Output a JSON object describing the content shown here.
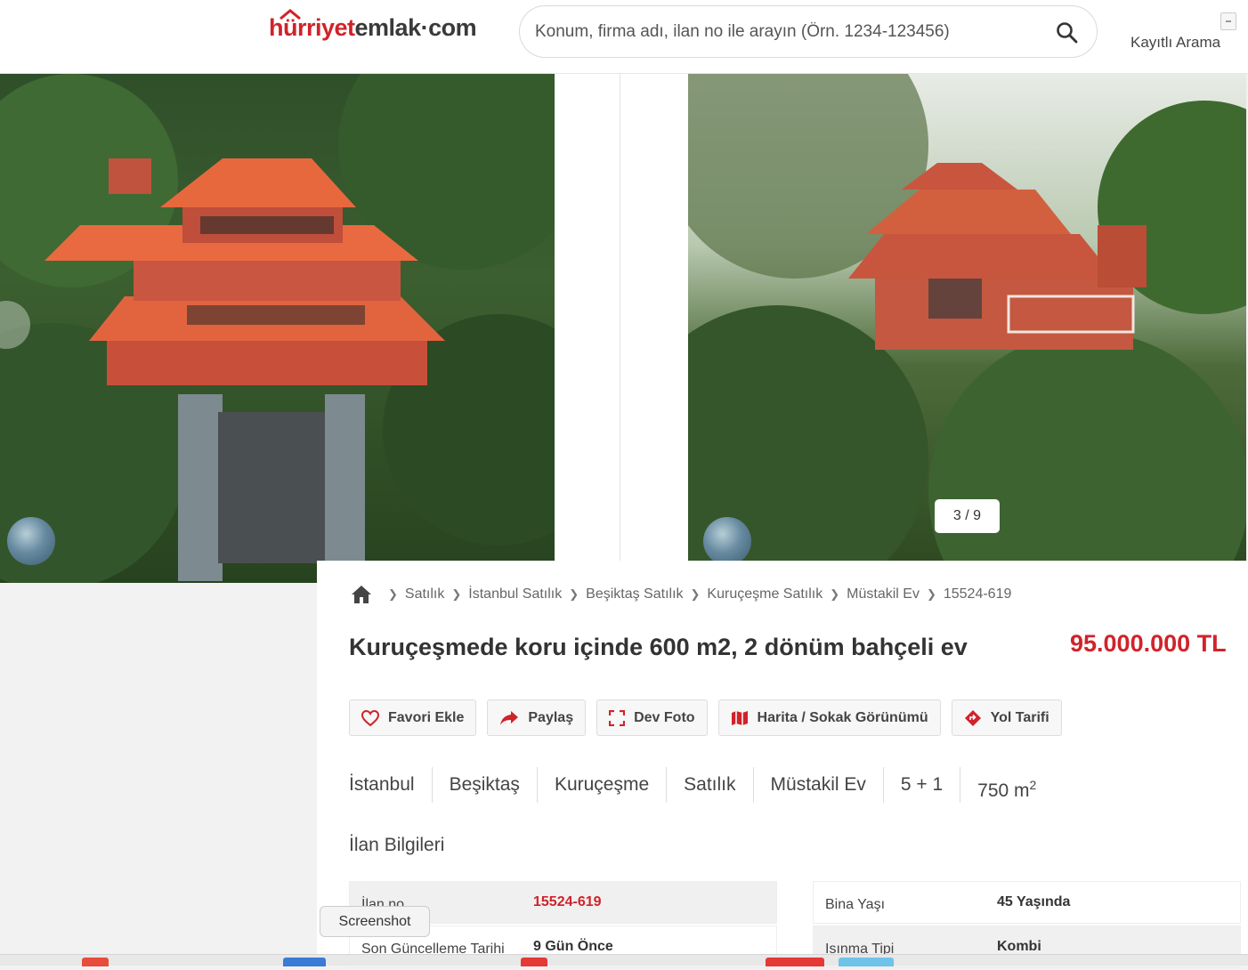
{
  "header": {
    "logo_part1": "hürriyet",
    "logo_part2": "emlak·com",
    "search_placeholder": "Konum, firma adı, ilan no ile arayın (Örn. 1234-123456)",
    "saved_search_label": "Kayıtlı Arama"
  },
  "gallery": {
    "counter": "3 / 9"
  },
  "breadcrumb": [
    "Satılık",
    "İstanbul Satılık",
    "Beşiktaş Satılık",
    "Kuruçeşme Satılık",
    "Müstakil Ev",
    "15524-619"
  ],
  "listing": {
    "title": "Kuruçeşmede koru içinde 600 m2, 2 dönüm bahçeli ev",
    "price": "95.000.000 TL"
  },
  "actions": {
    "favorite": "Favori Ekle",
    "share": "Paylaş",
    "big_photo": "Dev Foto",
    "map": "Harita / Sokak Görünümü",
    "directions": "Yol Tarifi"
  },
  "tags": {
    "city": "İstanbul",
    "district": "Beşiktaş",
    "neighborhood": "Kuruçeşme",
    "type": "Satılık",
    "category": "Müstakil Ev",
    "rooms": "5 + 1",
    "area": "750 m",
    "area_sup": "2"
  },
  "info": {
    "section_title": "İlan Bilgileri",
    "left": [
      {
        "key": "İlan no",
        "value": "15524-619"
      },
      {
        "key": "Son Güncelleme Tarihi",
        "value": "9 Gün Önce"
      }
    ],
    "right": [
      {
        "key": "Bina Yaşı",
        "value": "45 Yaşında"
      },
      {
        "key": "Isınma Tipi",
        "value": "Kombi"
      }
    ]
  },
  "tooltip": "Screenshot",
  "colors": {
    "brand_red": "#d0232a"
  }
}
